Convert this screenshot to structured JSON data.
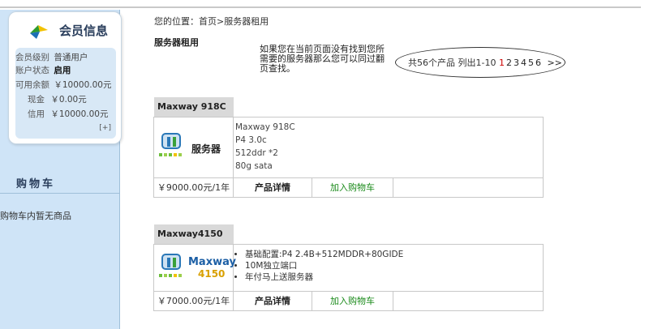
{
  "sidebar": {
    "member_title": "会员信息",
    "info": [
      {
        "label": "会员级别",
        "value": "普通用户"
      },
      {
        "label": "账户状态",
        "value": "启用"
      },
      {
        "label": "可用余额",
        "value": "￥10000.00元"
      },
      {
        "label": "现金",
        "value": "￥0.00元"
      },
      {
        "label": "信用",
        "value": "￥10000.00元"
      }
    ],
    "more": "[+]",
    "cart_title": "购物车",
    "cart_empty": "购物车内暂无商品"
  },
  "breadcrumb": {
    "prefix": "您的位置：",
    "home": "首页",
    "sep": ">",
    "current": "服务器租用"
  },
  "section_title": "服务器租用",
  "hint": "如果您在当前页面没有找到您所需要的服务器那么您可以同过翻页查找。",
  "pager": {
    "summary": "共56个产品 列出1-10",
    "current_page": "1",
    "pages": [
      "2",
      "3",
      "4",
      "5",
      "6"
    ],
    "next": ">>"
  },
  "products": [
    {
      "name": "Maxway 918C",
      "image_label": "服务器",
      "specs": [
        "Maxway 918C",
        "P4 3.0c",
        "512ddr *2",
        "80g sata"
      ],
      "price": "￥9000.00元/1年",
      "detail": "产品详情",
      "add_to_cart": "加入购物车"
    },
    {
      "name": "Maxway4150",
      "image_label_1": "Maxway",
      "image_label_2": "4150",
      "bullets": [
        "基础配置:P4 2.4B+512MDDR+80GIDE",
        "10M独立端口",
        "年付马上送服务器"
      ],
      "price": "￥7000.00元/1年",
      "detail": "产品详情",
      "add_to_cart": "加入购物车"
    }
  ],
  "colors": {
    "accent": "#2a3e5c",
    "sidebar_bg": "#cfe4f7",
    "link_green": "#1a8a1a",
    "current_page": "#c00000"
  }
}
